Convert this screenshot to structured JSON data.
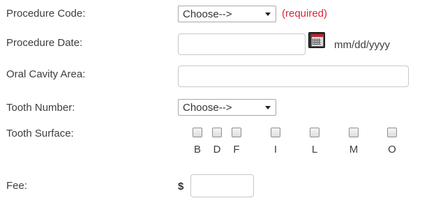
{
  "form": {
    "procedure_code": {
      "label": "Procedure Code:",
      "value": "Choose-->",
      "required_note": "(required)"
    },
    "procedure_date": {
      "label": "Procedure Date:",
      "value": "",
      "format_hint": "mm/dd/yyyy",
      "calendar_icon": "calendar-icon"
    },
    "oral_cavity_area": {
      "label": "Oral Cavity Area:",
      "value": ""
    },
    "tooth_number": {
      "label": "Tooth Number:",
      "value": "Choose-->"
    },
    "tooth_surface": {
      "label": "Tooth Surface:",
      "options": [
        "B",
        "D",
        "F",
        "I",
        "L",
        "M",
        "O"
      ]
    },
    "fee": {
      "label": "Fee:",
      "currency": "$",
      "value": ""
    }
  },
  "colors": {
    "required": "#d9253a",
    "border": "#c8c8c8"
  }
}
